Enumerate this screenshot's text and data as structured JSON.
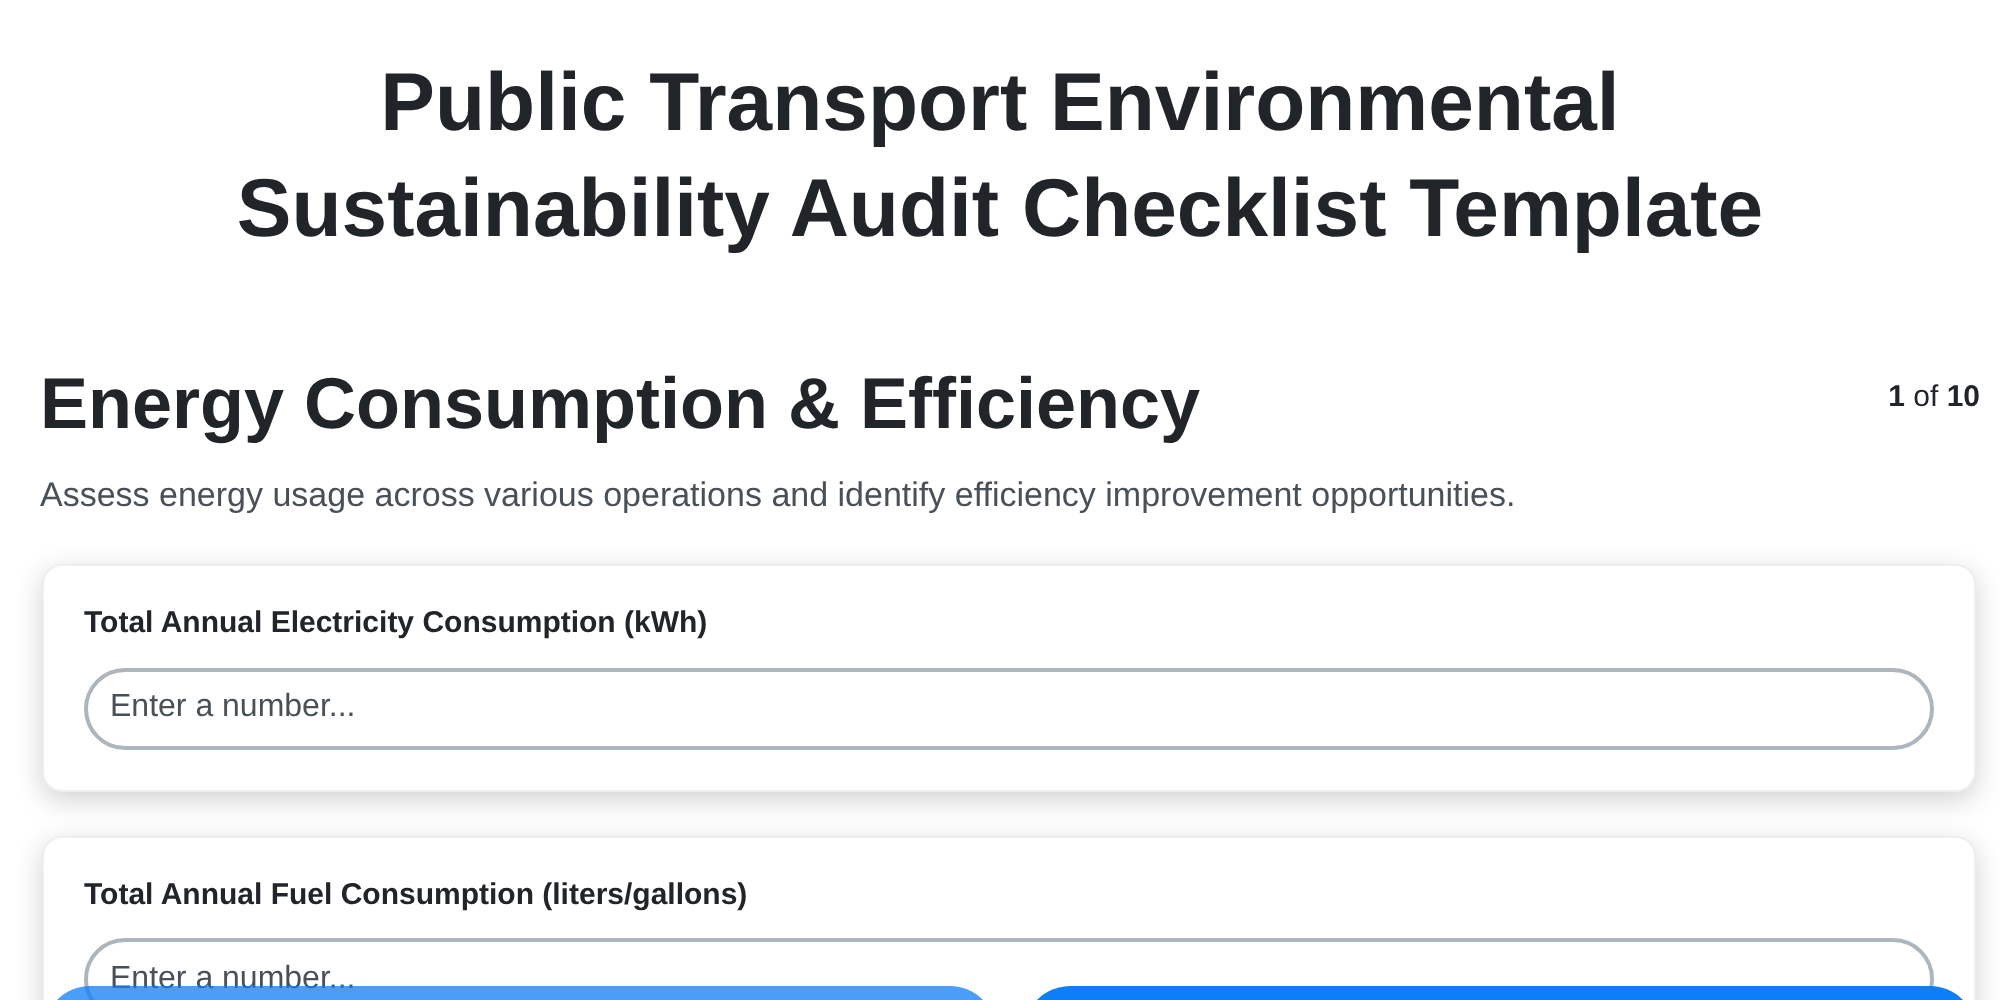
{
  "title": "Public Transport Environmental Sustainability Audit Checklist Template",
  "section": {
    "heading": "Energy Consumption & Efficiency",
    "counter": "**1** of **10**",
    "description": "Assess energy usage across various operations and identify efficiency improvement opportunities."
  },
  "questions": [
    {
      "label": "Total Annual Electricity Consumption (kWh)",
      "placeholder": "Enter a number..."
    },
    {
      "label": "Total Annual Fuel Consumption (liters/gallons)",
      "placeholder": "Enter a number..."
    }
  ],
  "nav_buttons": [
    {
      "disabled": true
    },
    {
      "disabled": false
    }
  ]
}
